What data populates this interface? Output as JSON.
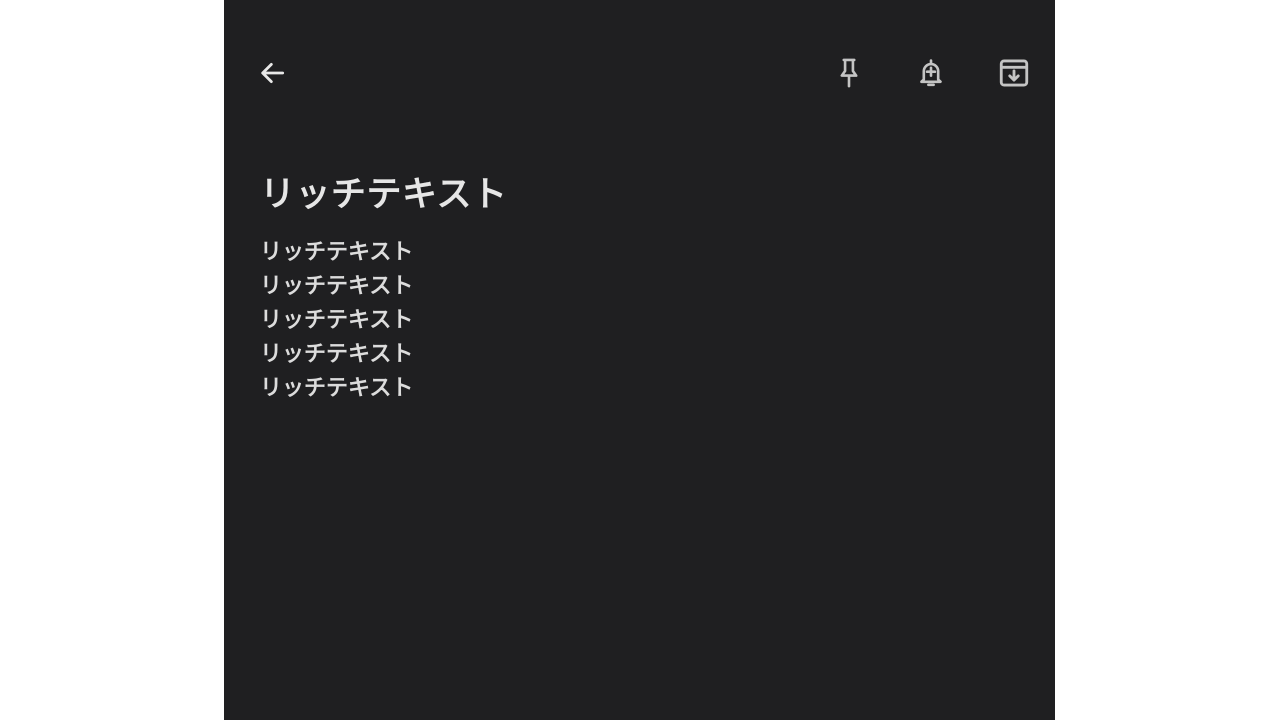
{
  "toolbar": {
    "back_icon": "arrow-back-icon",
    "pin_icon": "pin-icon",
    "reminder_icon": "add-alert-bell-icon",
    "archive_icon": "archive-box-icon"
  },
  "note": {
    "title": "リッチテキスト",
    "lines": [
      "リッチテキスト",
      "リッチテキスト",
      "リッチテキスト",
      "リッチテキスト",
      "リッチテキスト"
    ]
  },
  "colors": {
    "background": "#1f1f21",
    "page_margin": "#ffffff",
    "text": "#e3e3e3",
    "icon": "#c4c4c4"
  }
}
